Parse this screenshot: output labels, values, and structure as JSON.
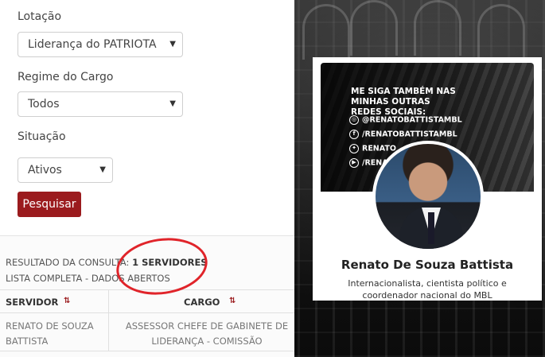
{
  "form": {
    "lotacao_label": "Lotação",
    "lotacao_value": "Liderança do PATRIOTA",
    "regime_label": "Regime do Cargo",
    "regime_value": "Todos",
    "situacao_label": "Situação",
    "situacao_value": "Ativos",
    "search_button": "Pesquisar"
  },
  "results": {
    "title_prefix": "RESULTADO DA CONSULTA:",
    "count": "1 SERVIDORES",
    "subtitle": "LISTA COMPLETA - DADOS ABERTOS",
    "columns": [
      "SERVIDOR",
      "CARGO"
    ],
    "rows": [
      {
        "servidor": "RENATO DE SOUZA BATTISTA",
        "cargo": "ASSESSOR CHEFE DE GABINETE DE LIDERANÇA - COMISSÃO"
      }
    ]
  },
  "profile": {
    "banner_heading": "ME SIGA TAMBÉM NAS MINHAS OUTRAS REDES SOCIAIS:",
    "socials": [
      "@RENATOBATTISTAMBL",
      "/RENATOBATTISTAMBL",
      "RENATO",
      "/RENATO"
    ],
    "name": "Renato De Souza Battista",
    "bio": "Internacionalista, cientista político e coordenador nacional do MBL"
  },
  "colors": {
    "button": "#9b1b1e",
    "annotation": "#e0242a"
  }
}
